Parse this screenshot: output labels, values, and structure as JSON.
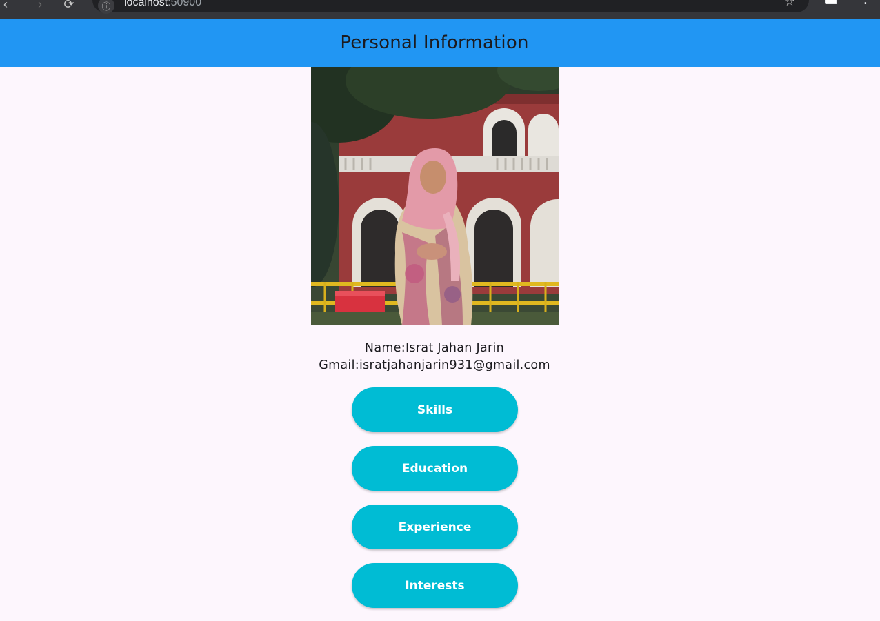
{
  "browser": {
    "url_host": "localhost",
    "url_port": ":50900"
  },
  "app_bar": {
    "title": "Personal Information"
  },
  "profile": {
    "name_line": "Name:Israt Jahan Jarin",
    "email_line": "Gmail:isratjahanjarin931@gmail.com"
  },
  "buttons": {
    "skills": "Skills",
    "education": "Education",
    "experience": "Experience",
    "interests": "Interests"
  },
  "colors": {
    "app_bar": "#2196f3",
    "button": "#00bcd4",
    "background": "#fdf6fd"
  }
}
